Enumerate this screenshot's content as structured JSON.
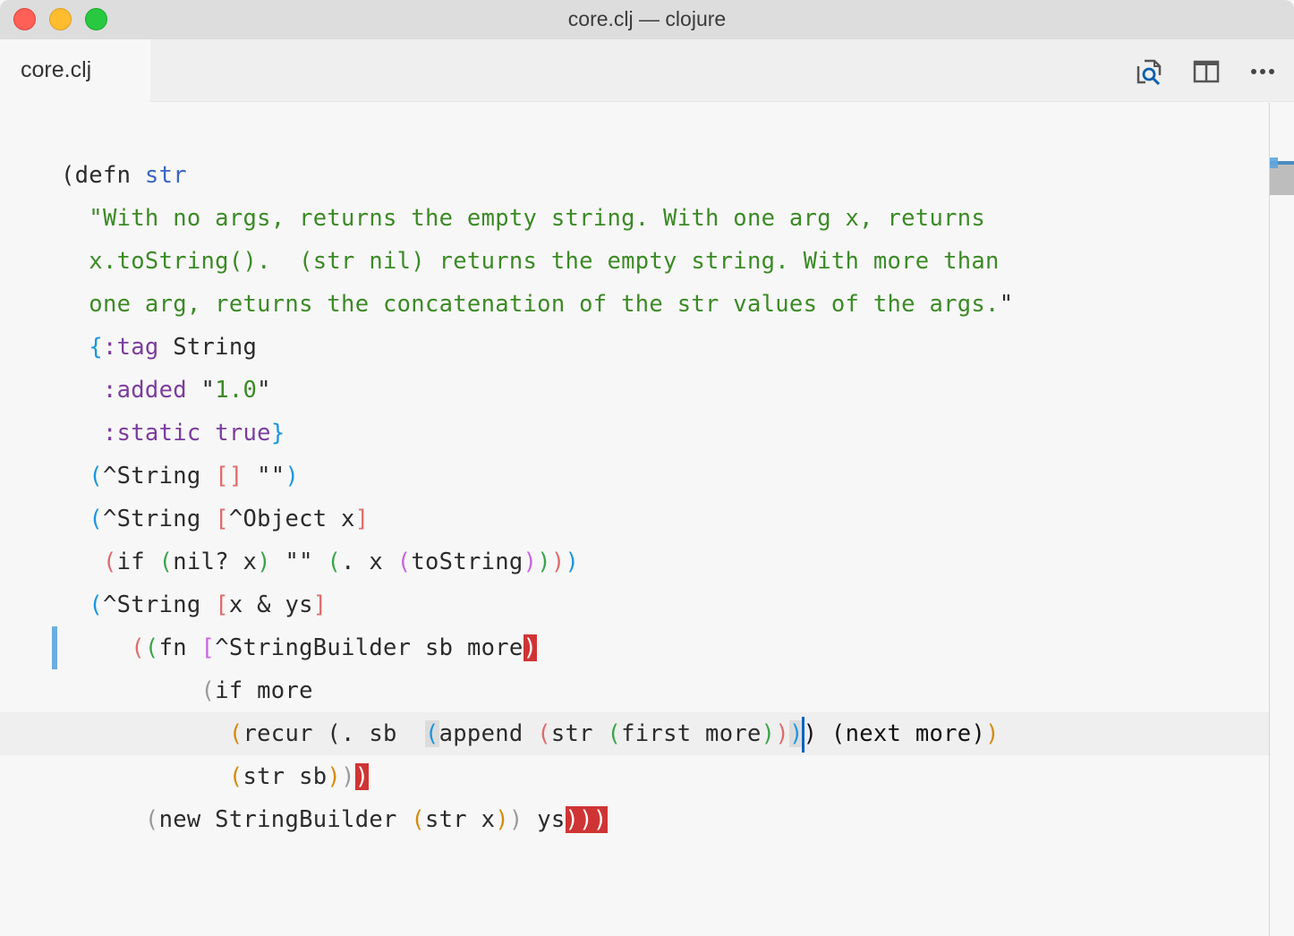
{
  "window": {
    "title": "core.clj — clojure"
  },
  "tabs": [
    {
      "label": "core.clj",
      "active": true
    }
  ],
  "toolbar": {
    "icons": [
      "search-file-icon",
      "split-editor-icon",
      "more-actions-icon"
    ]
  },
  "colors": {
    "string": "#3b8a25",
    "keyword": "#7b3c9e",
    "function_name": "#3a66c4",
    "bracket_error": "#cf3434",
    "cursor": "#0a62c0",
    "gutter_change": "#6aaee0"
  },
  "editor": {
    "language": "clojure",
    "cursor_line": 14,
    "lines": [
      [
        {
          "t": "(",
          "c": "k"
        },
        {
          "t": "defn ",
          "c": "k"
        },
        {
          "t": "str",
          "c": "fn"
        }
      ],
      [
        {
          "t": "  \"With no args, returns the empty string. With one arg x, returns",
          "c": "s"
        }
      ],
      [
        {
          "t": "  x.toString().  (str nil) returns the empty string. With more than",
          "c": "s"
        }
      ],
      [
        {
          "t": "  one arg, returns the concatenation of the str values of the args.",
          "c": "s"
        },
        {
          "t": "\"",
          "c": "k"
        }
      ],
      [
        {
          "t": "  ",
          "c": "k"
        },
        {
          "t": "{",
          "c": "b-blue"
        },
        {
          "t": ":tag",
          "c": "kw"
        },
        {
          "t": " String",
          "c": "k"
        }
      ],
      [
        {
          "t": "   ",
          "c": "k"
        },
        {
          "t": ":added",
          "c": "kw"
        },
        {
          "t": " \"",
          "c": "k"
        },
        {
          "t": "1.0",
          "c": "s"
        },
        {
          "t": "\"",
          "c": "k"
        }
      ],
      [
        {
          "t": "   ",
          "c": "k"
        },
        {
          "t": ":static",
          "c": "kw"
        },
        {
          "t": " ",
          "c": "k"
        },
        {
          "t": "true",
          "c": "kw"
        },
        {
          "t": "}",
          "c": "b-blue"
        }
      ],
      [
        {
          "t": "  ",
          "c": "k"
        },
        {
          "t": "(",
          "c": "b-blue"
        },
        {
          "t": "^String ",
          "c": "k"
        },
        {
          "t": "[]",
          "c": "b-red"
        },
        {
          "t": " \"\"",
          "c": "k"
        },
        {
          "t": ")",
          "c": "b-blue"
        }
      ],
      [
        {
          "t": "  ",
          "c": "k"
        },
        {
          "t": "(",
          "c": "b-blue"
        },
        {
          "t": "^String ",
          "c": "k"
        },
        {
          "t": "[",
          "c": "b-red"
        },
        {
          "t": "^Object x",
          "c": "k"
        },
        {
          "t": "]",
          "c": "b-red"
        }
      ],
      [
        {
          "t": "   ",
          "c": "k"
        },
        {
          "t": "(",
          "c": "b-red"
        },
        {
          "t": "if ",
          "c": "k"
        },
        {
          "t": "(",
          "c": "b-green"
        },
        {
          "t": "nil? x",
          "c": "k"
        },
        {
          "t": ")",
          "c": "b-green"
        },
        {
          "t": " \"\" ",
          "c": "k"
        },
        {
          "t": "(",
          "c": "b-green"
        },
        {
          "t": ". x ",
          "c": "k"
        },
        {
          "t": "(",
          "c": "b-purple"
        },
        {
          "t": "toString",
          "c": "k"
        },
        {
          "t": ")",
          "c": "b-purple"
        },
        {
          "t": ")",
          "c": "b-green"
        },
        {
          "t": ")",
          "c": "b-red"
        },
        {
          "t": ")",
          "c": "b-blue"
        }
      ],
      [
        {
          "t": "  ",
          "c": "k"
        },
        {
          "t": "(",
          "c": "b-blue"
        },
        {
          "t": "^String ",
          "c": "k"
        },
        {
          "t": "[",
          "c": "b-red"
        },
        {
          "t": "x & ys",
          "c": "k"
        },
        {
          "t": "]",
          "c": "b-red"
        }
      ],
      [
        {
          "t": "     ",
          "c": "k"
        },
        {
          "t": "(",
          "c": "b-red"
        },
        {
          "t": "(",
          "c": "b-green"
        },
        {
          "t": "fn ",
          "c": "k"
        },
        {
          "t": "[",
          "c": "b-purple"
        },
        {
          "t": "^StringBuilder sb more",
          "c": "k"
        },
        {
          "t": ")",
          "c": "err"
        }
      ],
      [
        {
          "t": "          ",
          "c": "k"
        },
        {
          "t": "(",
          "c": "b-gray"
        },
        {
          "t": "if more",
          "c": "k"
        }
      ],
      [
        {
          "t": "            ",
          "c": "k"
        },
        {
          "t": "(",
          "c": "b-orange"
        },
        {
          "t": "recur (. sb  ",
          "c": "k"
        },
        {
          "t": "(",
          "c": "b-blue match"
        },
        {
          "t": "append ",
          "c": "k"
        },
        {
          "t": "(",
          "c": "b-red"
        },
        {
          "t": "str ",
          "c": "k"
        },
        {
          "t": "(",
          "c": "b-green"
        },
        {
          "t": "first more",
          "c": "k"
        },
        {
          "t": ")",
          "c": "b-green"
        },
        {
          "t": ")",
          "c": "b-red"
        },
        {
          "t": ")",
          "c": "b-blue match"
        },
        {
          "t": "",
          "c": "cursor"
        },
        {
          "t": ") (next more)",
          "c": "b-black"
        },
        {
          "t": ")",
          "c": "b-orange"
        }
      ],
      [
        {
          "t": "            ",
          "c": "k"
        },
        {
          "t": "(",
          "c": "b-orange"
        },
        {
          "t": "str sb",
          "c": "k"
        },
        {
          "t": ")",
          "c": "b-orange"
        },
        {
          "t": ")",
          "c": "b-gray"
        },
        {
          "t": ")",
          "c": "err"
        }
      ],
      [
        {
          "t": "      ",
          "c": "k"
        },
        {
          "t": "(",
          "c": "b-gray"
        },
        {
          "t": "new StringBuilder ",
          "c": "k"
        },
        {
          "t": "(",
          "c": "b-orange"
        },
        {
          "t": "str x",
          "c": "k"
        },
        {
          "t": ")",
          "c": "b-orange"
        },
        {
          "t": ")",
          "c": "b-gray"
        },
        {
          "t": " ys",
          "c": "k"
        },
        {
          "t": ")))",
          "c": "err"
        }
      ]
    ]
  }
}
